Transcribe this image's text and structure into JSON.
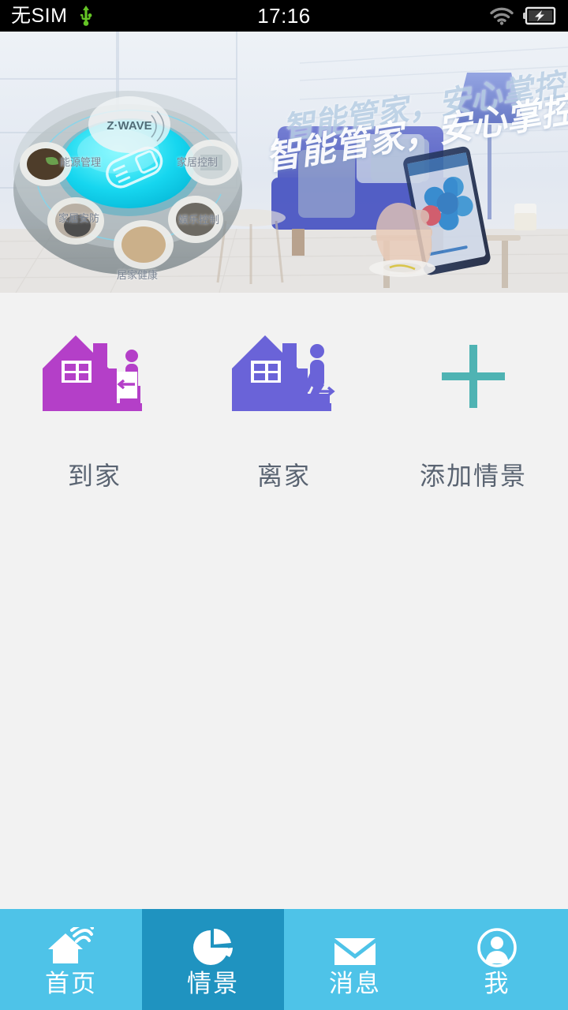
{
  "status_bar": {
    "carrier": "无SIM",
    "usb_icon": "usb-icon",
    "clock": "17:16",
    "wifi_icon": "wifi-icon",
    "battery_icon": "battery-charging-icon"
  },
  "banner": {
    "headline_shadow": "智能管家，安心掌控！",
    "headline": "智能管家，安心掌控！",
    "brand_logo": "Z·WAVE",
    "hub_labels": [
      "能源管理",
      "家居控制",
      "家居安防",
      "娱乐控制",
      "居家健康"
    ]
  },
  "scenes": {
    "items": [
      {
        "label": "到家",
        "icon": "house-arrive-icon",
        "color": "#b43fc8"
      },
      {
        "label": "离家",
        "icon": "house-leave-icon",
        "color": "#6a63d8"
      },
      {
        "label": "添加情景",
        "icon": "plus-icon",
        "color": "#4fb3b3"
      }
    ]
  },
  "tabbar": {
    "active_index": 1,
    "colors": {
      "normal": "#4ec3e8",
      "active": "#1f93c0",
      "label": "#ffffff"
    },
    "items": [
      {
        "label": "首页",
        "icon": "home-wifi-icon"
      },
      {
        "label": "情景",
        "icon": "pie-chart-icon"
      },
      {
        "label": "消息",
        "icon": "envelope-icon"
      },
      {
        "label": "我",
        "icon": "person-circle-icon"
      }
    ]
  }
}
